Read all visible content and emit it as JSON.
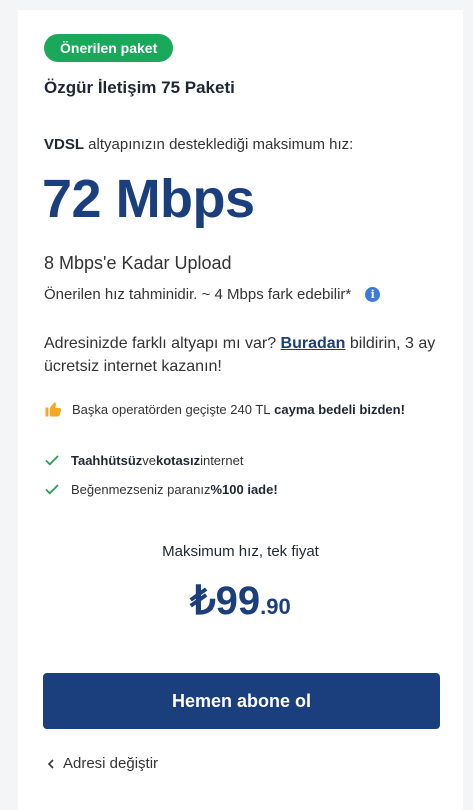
{
  "badge": "Önerilen paket",
  "package_title": "Özgür İletişim 75 Paketi",
  "infra": {
    "tech": "VDSL",
    "text": " altyapınızın desteklediği maksimum hız:"
  },
  "speed": "72 Mbps",
  "upload": "8 Mbps'e Kadar Upload",
  "speed_note": "Önerilen hız tahminidir. ~ 4 Mbps fark edebilir*",
  "different_infra": {
    "before": "Adresinizde farklı altyapı mı var? ",
    "link": "Buradan",
    "after": " bildirin, 3 ay ücretsiz internet kazanın!"
  },
  "promo": {
    "before": "Başka operatörden geçişte 240 TL ",
    "bold": "cayma bedeli bizden!"
  },
  "features": [
    {
      "bold": "Taahhütsüz",
      "mid": " ve ",
      "bold2": "kotasız",
      "after": " internet"
    },
    {
      "before": "Beğenmezseniz paranız ",
      "bold": "%100 iade!"
    }
  ],
  "max_line": "Maksimum hız, tek fiyat",
  "price": {
    "main": "₺99",
    "cents": ".90"
  },
  "cta_label": "Hemen abone ol",
  "back_label": "Adresi değiştir",
  "colors": {
    "accent": "#1b3f7c",
    "badge": "#1aa95a",
    "info": "#3a7bdc",
    "check": "#2e9d5a",
    "thumb": "#f5a623"
  }
}
